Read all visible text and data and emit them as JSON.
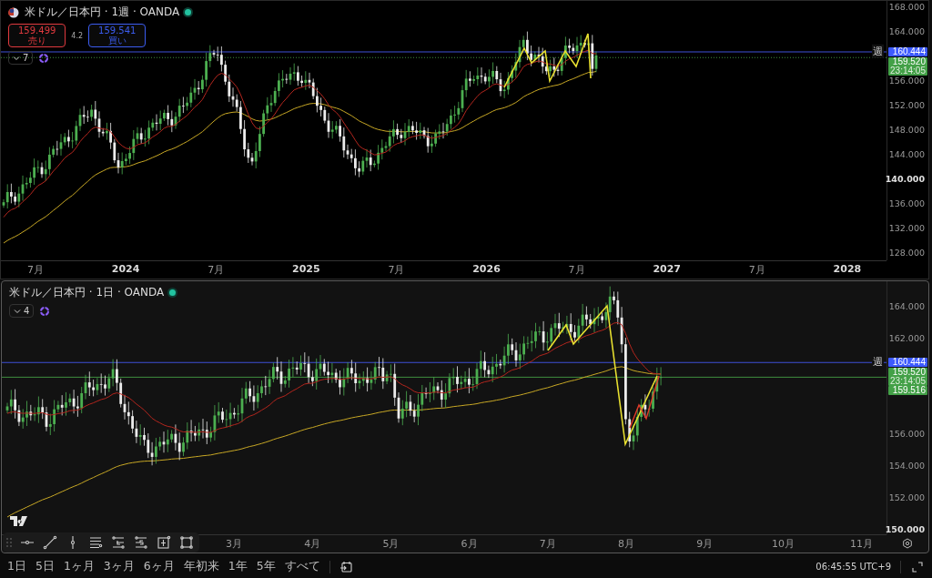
{
  "charts": [
    {
      "title": "米ドル／日本円 · 1週 · OANDA",
      "live": true,
      "sell": {
        "price": "159.499",
        "label": "売り"
      },
      "spread": "4.2",
      "buy": {
        "price": "159.541",
        "label": "買い"
      },
      "indicator_count": "7",
      "price_ticks": [
        {
          "label": "168.000",
          "major": false
        },
        {
          "label": "164.000",
          "major": false
        },
        {
          "label": "156.000",
          "major": false
        },
        {
          "label": "152.000",
          "major": false
        },
        {
          "label": "148.000",
          "major": false
        },
        {
          "label": "144.000",
          "major": false
        },
        {
          "label": "140.000",
          "major": true
        },
        {
          "label": "136.000",
          "major": false
        },
        {
          "label": "132.000",
          "major": false
        },
        {
          "label": "128.000",
          "major": false
        }
      ],
      "time_labels": [
        {
          "text": "7月",
          "major": false
        },
        {
          "text": "2024",
          "major": true
        },
        {
          "text": "7月",
          "major": false
        },
        {
          "text": "2025",
          "major": true
        },
        {
          "text": "7月",
          "major": false
        },
        {
          "text": "2026",
          "major": true
        },
        {
          "text": "7月",
          "major": false
        },
        {
          "text": "2027",
          "major": true
        },
        {
          "text": "7月",
          "major": false
        },
        {
          "text": "2028",
          "major": true
        }
      ],
      "line_tag": "週",
      "alert_price": "160.444",
      "last_price": "159.520",
      "countdown": "23:14:05"
    },
    {
      "title": "米ドル／日本円 · 1日 · OANDA",
      "live": true,
      "indicator_count": "4",
      "price_ticks": [
        {
          "label": "164.000",
          "major": false
        },
        {
          "label": "162.000",
          "major": false
        },
        {
          "label": "156.000",
          "major": false
        },
        {
          "label": "154.000",
          "major": false
        },
        {
          "label": "152.000",
          "major": false
        },
        {
          "label": "150.000",
          "major": true
        }
      ],
      "time_labels": [
        {
          "text": "3月",
          "major": false
        },
        {
          "text": "4月",
          "major": false
        },
        {
          "text": "5月",
          "major": false
        },
        {
          "text": "6月",
          "major": false
        },
        {
          "text": "7月",
          "major": false
        },
        {
          "text": "8月",
          "major": false
        },
        {
          "text": "9月",
          "major": false
        },
        {
          "text": "10月",
          "major": false
        },
        {
          "text": "11月",
          "major": false
        }
      ],
      "line_tag": "週",
      "alert_price": "160.444",
      "last_price": "159.520",
      "countdown": "23:14:05",
      "bid_price": "159.516"
    }
  ],
  "range_buttons": [
    "1日",
    "5日",
    "1ヶ月",
    "3ヶ月",
    "6ヶ月",
    "年初来",
    "1年",
    "5年",
    "すべて"
  ],
  "clock": "06:45:55 UTC+9"
}
